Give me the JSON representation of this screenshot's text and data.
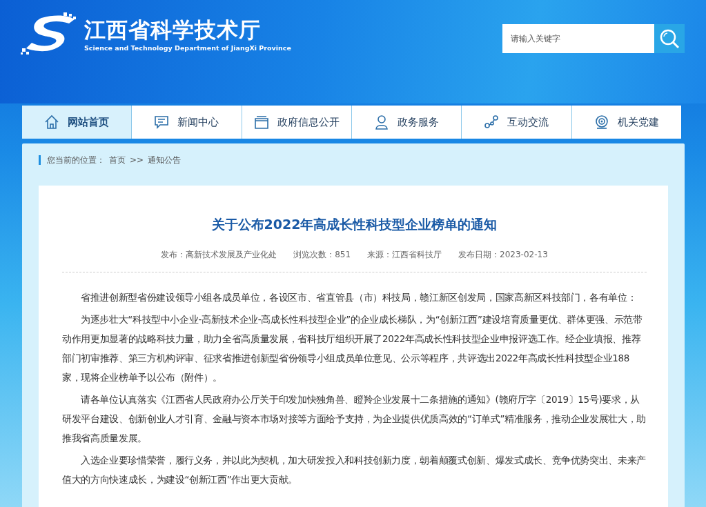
{
  "header": {
    "title": "江西省科学技术厅",
    "subtitle": "Science and Technology Department of JiangXi Province"
  },
  "search": {
    "placeholder": "请输入关键字"
  },
  "nav": [
    {
      "label": "网站首页",
      "kind": "home",
      "selected": true
    },
    {
      "label": "新闻中心",
      "kind": "news",
      "selected": false
    },
    {
      "label": "政府信息公开",
      "kind": "info",
      "selected": false
    },
    {
      "label": "政务服务",
      "kind": "service",
      "selected": false
    },
    {
      "label": "互动交流",
      "kind": "interact",
      "selected": false
    },
    {
      "label": "机关党建",
      "kind": "party",
      "selected": false
    }
  ],
  "breadcrumb": {
    "prefix": "您当前的位置：",
    "items": [
      "首页",
      "通知公告"
    ],
    "separator": ">>"
  },
  "article": {
    "title": "关于公布2022年高成长性科技型企业榜单的通知",
    "meta": [
      "发布：高新技术发展及产业化处",
      "浏览次数：851",
      "来源：江西省科技厅",
      "发布日期：2023-02-13"
    ],
    "paragraphs": [
      "省推进创新型省份建设领导小组各成员单位，各设区市、省直管县（市）科技局，赣江新区创发局，国家高新区科技部门，各有单位：",
      "为逐步壮大“科技型中小企业-高新技术企业-高成长性科技型企业”的企业成长梯队，为“创新江西”建设培育质量更优、群体更强、示范带动作用更加显著的战略科技力量，助力全省高质量发展，省科技厅组织开展了2022年高成长性科技型企业申报评选工作。经企业填报、推荐部门初审推荐、第三方机构评审、征求省推进创新型省份领导小组成员单位意见、公示等程序，共评选出2022年高成长性科技型企业188家，现将企业榜单予以公布（附件）。",
      "请各单位认真落实《江西省人民政府办公厅关于印发加快独角兽、瞪羚企业发展十二条措施的通知》(赣府厅字〔2019〕15号)要求，从研发平台建设、创新创业人才引育、金融与资本市场对接等方面给予支持，为企业提供优质高效的“订单式”精准服务，推动企业发展壮大，助推我省高质量发展。",
      "入选企业要珍惜荣誉，履行义务，并以此为契机，加大研发投入和科技创新力度，朝着颠覆式创新、爆发式成长、竞争优势突出、未来产值大的方向快速成长，为建设“创新江西”作出更大贡献。"
    ]
  }
}
